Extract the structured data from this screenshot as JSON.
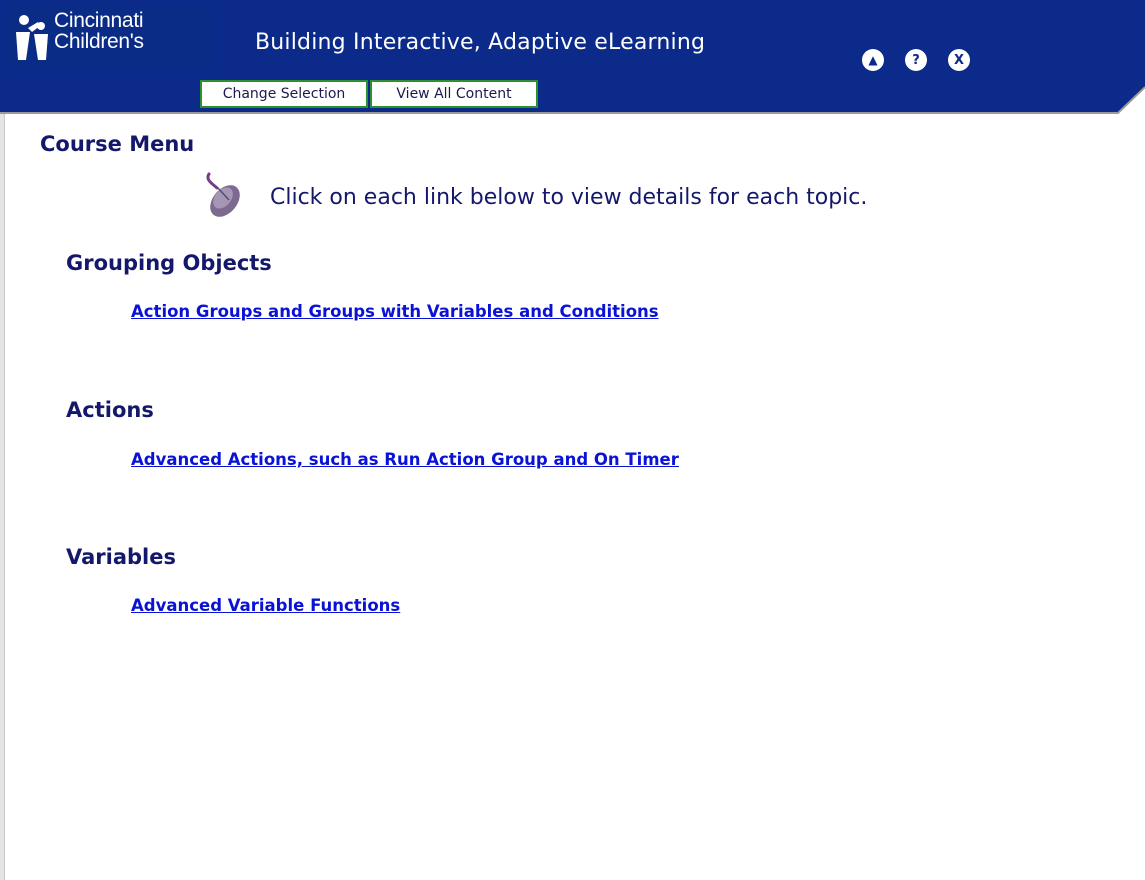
{
  "header": {
    "logo": {
      "line1": "Cincinnati",
      "line2": "Children's"
    },
    "title": "Building Interactive, Adaptive eLearning",
    "buttons": [
      {
        "glyph": "▲",
        "icon": "home-icon"
      },
      {
        "glyph": "?",
        "icon": "help-icon"
      },
      {
        "glyph": "X",
        "icon": "close-icon"
      }
    ],
    "tabs": [
      "Change Selection",
      "View All Content"
    ],
    "colors": {
      "bar": "#0b2a8a",
      "tab_border": "#2d8f2d"
    }
  },
  "main": {
    "heading": "Course Menu",
    "instruction": "Click on each link below to view details for each topic.",
    "instruction_icon": "mouse-icon",
    "sections": [
      {
        "title": "Grouping Objects",
        "link": "Action Groups and Groups with Variables and Conditions"
      },
      {
        "title": "Actions",
        "link": "Advanced Actions, such as Run Action Group and On Timer"
      },
      {
        "title": "Variables",
        "link": "Advanced Variable Functions"
      }
    ],
    "colors": {
      "heading": "#14186b",
      "link": "#0a12d6"
    }
  }
}
